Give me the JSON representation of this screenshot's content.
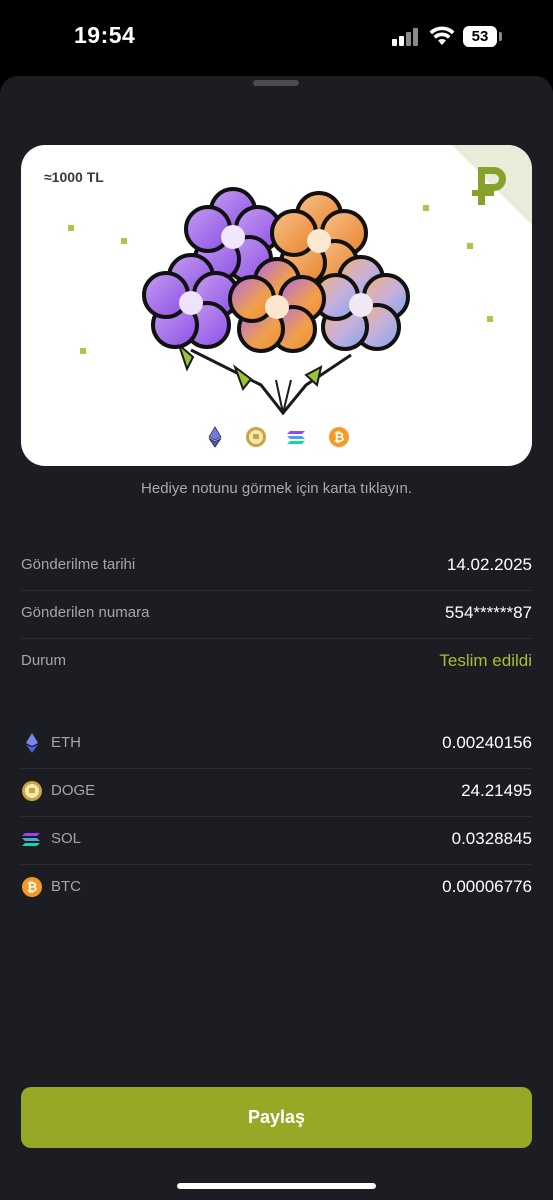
{
  "status_bar": {
    "time": "19:54",
    "battery": "53"
  },
  "card": {
    "amount": "≈1000 TL",
    "brand_letter": "P"
  },
  "hint": "Hediye notunu görmek için karta tıklayın.",
  "details": [
    {
      "label": "Gönderilme tarihi",
      "value": "14.02.2025"
    },
    {
      "label": "Gönderilen numara",
      "value": "554******87"
    },
    {
      "label": "Durum",
      "value": "Teslim edildi"
    }
  ],
  "assets": [
    {
      "name": "ETH",
      "value": "0.00240156",
      "icon": "ethereum-icon"
    },
    {
      "name": "DOGE",
      "value": "24.21495",
      "icon": "dogecoin-icon"
    },
    {
      "name": "SOL",
      "value": "0.0328845",
      "icon": "solana-icon"
    },
    {
      "name": "BTC",
      "value": "0.00006776",
      "icon": "bitcoin-icon"
    }
  ],
  "share_label": "Paylaş",
  "colors": {
    "accent": "#97a826",
    "status_green": "#a8bd34",
    "background": "#1c1d22"
  }
}
